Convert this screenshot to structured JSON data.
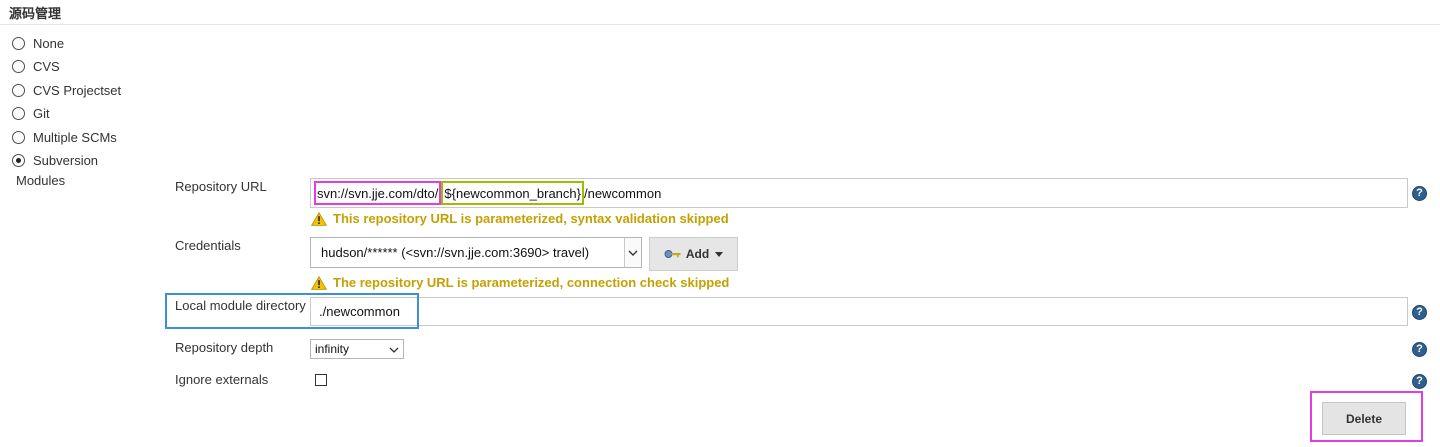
{
  "section": {
    "title": "源码管理"
  },
  "scm_options": [
    {
      "label": "None",
      "selected": false
    },
    {
      "label": "CVS",
      "selected": false
    },
    {
      "label": "CVS Projectset",
      "selected": false
    },
    {
      "label": "Git",
      "selected": false
    },
    {
      "label": "Multiple SCMs",
      "selected": false
    },
    {
      "label": "Subversion",
      "selected": true
    }
  ],
  "modules_label": "Modules",
  "repository_url": {
    "label": "Repository URL",
    "value_part1": "svn://svn.jje.com/dto/",
    "value_part2": "${newcommon_branch}",
    "value_part3": "/newcommon",
    "warning": "This repository URL is parameterized, syntax validation skipped"
  },
  "credentials": {
    "label": "Credentials",
    "selected": "hudson/****** (<svn://svn.jje.com:3690> travel)",
    "add_label": "Add",
    "warning": "The repository URL is parameterized, connection check skipped"
  },
  "local_module_directory": {
    "label": "Local module directory",
    "value": "./newcommon"
  },
  "repository_depth": {
    "label": "Repository depth",
    "selected": "infinity"
  },
  "ignore_externals": {
    "label": "Ignore externals",
    "checked": false
  },
  "delete_label": "Delete",
  "help_glyph": "?",
  "colors": {
    "warning_text": "#c4a000",
    "annotation_magenta": "#e23de2",
    "annotation_green": "#9bbf00",
    "annotation_blue": "#3d8fd8",
    "help_icon": "#2f5f8f"
  },
  "icons": {
    "warning": "warning-triangle-icon",
    "help": "help-icon",
    "key": "key-icon",
    "dropdown": "chevron-down-icon"
  }
}
